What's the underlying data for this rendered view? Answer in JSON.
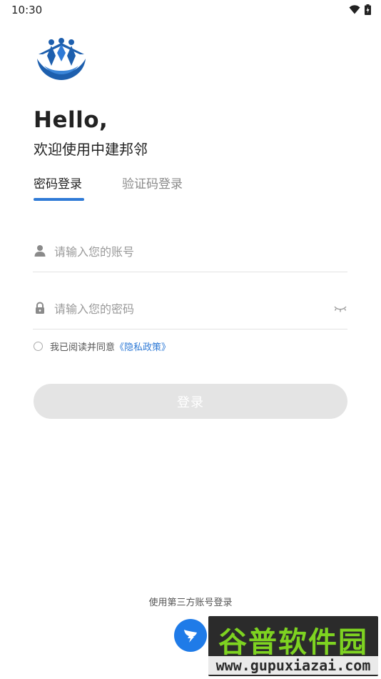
{
  "status_bar": {
    "time": "10:30"
  },
  "header": {
    "hello": "Hello,",
    "welcome": "欢迎使用中建邦邻"
  },
  "tabs": [
    {
      "label": "密码登录",
      "active": true
    },
    {
      "label": "验证码登录",
      "active": false
    }
  ],
  "form": {
    "account": {
      "placeholder": "请输入您的账号",
      "value": "",
      "icon": "user-icon"
    },
    "password": {
      "placeholder": "请输入您的密码",
      "value": "",
      "icon": "lock-icon",
      "toggle_icon": "eye-closed-icon"
    }
  },
  "agreement": {
    "text": "我已阅读并同意",
    "link": "《隐私政策》",
    "checked": false
  },
  "login_button": {
    "label": "登录"
  },
  "third_party": {
    "label": "使用第三方账号登录",
    "icon": "dingtalk-icon"
  },
  "watermark": {
    "title": "谷普软件园",
    "url": "www.gupuxiazai.com"
  },
  "colors": {
    "accent": "#2f7ad6",
    "button_disabled": "#e4e4e4",
    "dingtalk": "#1f7be8"
  }
}
